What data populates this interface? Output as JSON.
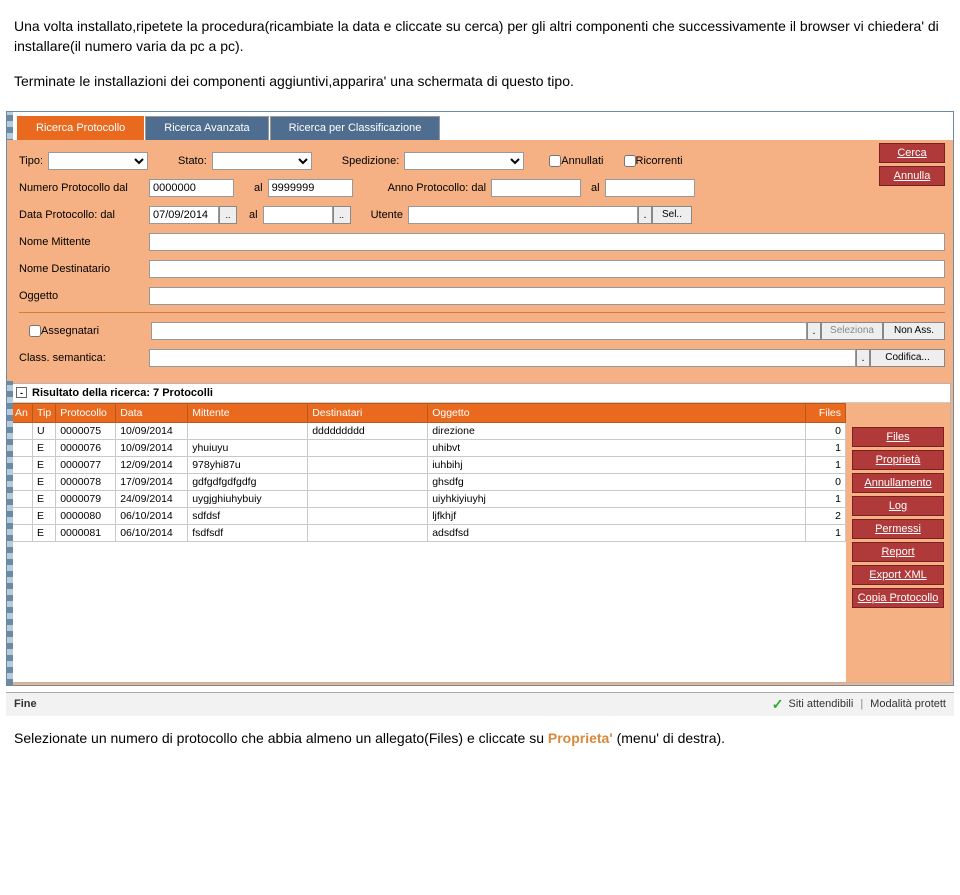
{
  "doc": {
    "p1": "Una volta installato,ripetete la procedura(ricambiate la data e cliccate su cerca) per gli altri componenti che successivamente il browser vi chiedera' di installare(il numero varia da pc a pc).",
    "p2": "Terminate le installazioni dei componenti aggiuntivi,apparira' una schermata di questo tipo.",
    "p3a": "Selezionate un numero di protocollo che abbia almeno un allegato(Files) e cliccate su ",
    "p3b": "Proprieta'",
    "p3c": "(menu' di destra)."
  },
  "tabs": {
    "t1": "Ricerca Protocollo",
    "t2": "Ricerca Avanzata",
    "t3": "Ricerca per Classificazione"
  },
  "rbuttons": {
    "cerca": "Cerca",
    "annulla": "Annulla"
  },
  "form": {
    "tipo": "Tipo:",
    "stato": "Stato:",
    "spedizione": "Spedizione:",
    "annullati": "Annullati",
    "ricorrenti": "Ricorrenti",
    "numprot": "Numero Protocollo dal",
    "numprot_v1": "0000000",
    "al": "al",
    "numprot_v2": "9999999",
    "annoprot": "Anno Protocollo: dal",
    "dataprot": "Data Protocollo: dal",
    "data_v1": "07/09/2014",
    "utente": "Utente",
    "sel": "Sel..",
    "mittente": "Nome Mittente",
    "destinatario": "Nome Destinatario",
    "oggetto": "Oggetto",
    "assegnatari": "Assegnatari",
    "seleziona": "Seleziona",
    "nonass": "Non Ass.",
    "classsem": "Class. semantica:",
    "codifica": "Codifica...",
    "dot": "."
  },
  "results": {
    "title": "Risultato della ricerca: 7 Protocolli",
    "minus": "-",
    "headers": {
      "an": "An",
      "tip": "Tip",
      "protocollo": "Protocollo",
      "data": "Data",
      "mittente": "Mittente",
      "destinatari": "Destinatari",
      "oggetto": "Oggetto",
      "files": "Files"
    },
    "rows": [
      {
        "an": "",
        "tip": "U",
        "protocollo": "0000075",
        "data": "10/09/2014",
        "mittente": "",
        "destinatari": "ddddddddd",
        "oggetto": "direzione",
        "files": "0"
      },
      {
        "an": "",
        "tip": "E",
        "protocollo": "0000076",
        "data": "10/09/2014",
        "mittente": "yhuiuyu",
        "destinatari": "",
        "oggetto": "uhibvt",
        "files": "1"
      },
      {
        "an": "",
        "tip": "E",
        "protocollo": "0000077",
        "data": "12/09/2014",
        "mittente": "978yhi87u",
        "destinatari": "",
        "oggetto": "iuhbihj",
        "files": "1"
      },
      {
        "an": "",
        "tip": "E",
        "protocollo": "0000078",
        "data": "17/09/2014",
        "mittente": "gdfgdfgdfgdfg",
        "destinatari": "",
        "oggetto": "ghsdfg",
        "files": "0"
      },
      {
        "an": "",
        "tip": "E",
        "protocollo": "0000079",
        "data": "24/09/2014",
        "mittente": "uygjghiuhybuiy",
        "destinatari": "",
        "oggetto": "uiyhkiyiuyhj",
        "files": "1"
      },
      {
        "an": "",
        "tip": "E",
        "protocollo": "0000080",
        "data": "06/10/2014",
        "mittente": "sdfdsf",
        "destinatari": "",
        "oggetto": "ljfkhjf",
        "files": "2"
      },
      {
        "an": "",
        "tip": "E",
        "protocollo": "0000081",
        "data": "06/10/2014",
        "mittente": "fsdfsdf",
        "destinatari": "",
        "oggetto": "adsdfsd",
        "files": "1"
      }
    ]
  },
  "sidebtns": {
    "files": "Files",
    "proprieta": "Proprietà",
    "annullamento": "Annullamento",
    "log": "Log",
    "permessi": "Permessi",
    "report": "Report",
    "exportxml": "Export XML",
    "copia": "Copia Protocollo"
  },
  "footer": {
    "fine": "Fine",
    "siti": "Siti attendibili",
    "modalita": "Modalità protett"
  }
}
